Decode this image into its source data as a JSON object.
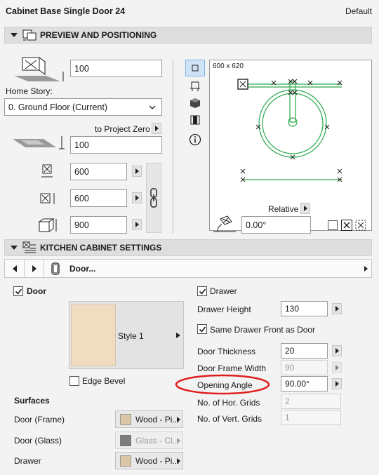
{
  "window": {
    "title": "Cabinet Base Single Door 24",
    "mode": "Default"
  },
  "section1": {
    "label": "PREVIEW AND POSITIONING"
  },
  "positioning": {
    "top_offset": "100",
    "home_story_label": "Home Story:",
    "home_story_value": "0. Ground Floor (Current)",
    "to_project_zero": "to Project Zero",
    "elevation": "100",
    "width": "600",
    "depth": "600",
    "height": "900"
  },
  "preview": {
    "size_label": "600 x 620",
    "relative_label": "Relative",
    "angle": "0.00°"
  },
  "section2": {
    "label": "KITCHEN CABINET SETTINGS"
  },
  "nav": {
    "page_label": "Door..."
  },
  "door": {
    "door_label": "Door",
    "style_label": "Style 1",
    "edge_bevel_label": "Edge Bevel",
    "surfaces_heading": "Surfaces",
    "surfaces": [
      {
        "label": "Door (Frame)",
        "value": "Wood - Pi...",
        "color": "#dcc6a6"
      },
      {
        "label": "Door (Glass)",
        "value": "Glass - Cl...",
        "color": "#7d7d7d"
      },
      {
        "label": "Drawer",
        "value": "Wood - Pi...",
        "color": "#dcc6a6"
      }
    ]
  },
  "drawer": {
    "drawer_label": "Drawer",
    "drawer_height_label": "Drawer Height",
    "drawer_height": "130",
    "same_front_label": "Same Drawer Front as Door",
    "door_thickness_label": "Door Thickness",
    "door_thickness": "20",
    "door_frame_width_label": "Door Frame Width",
    "door_frame_width": "90",
    "opening_angle_label": "Opening Angle",
    "opening_angle": "90.00°",
    "hor_grids_label": "No. of Hor. Grids",
    "hor_grids": "2",
    "vert_grids_label": "No. of Vert. Grids",
    "vert_grids": "1"
  },
  "colors": {
    "preview_green": "#2aa84a",
    "highlight_red": "#e01e1e",
    "style_swatch": "#f0dcc0"
  }
}
